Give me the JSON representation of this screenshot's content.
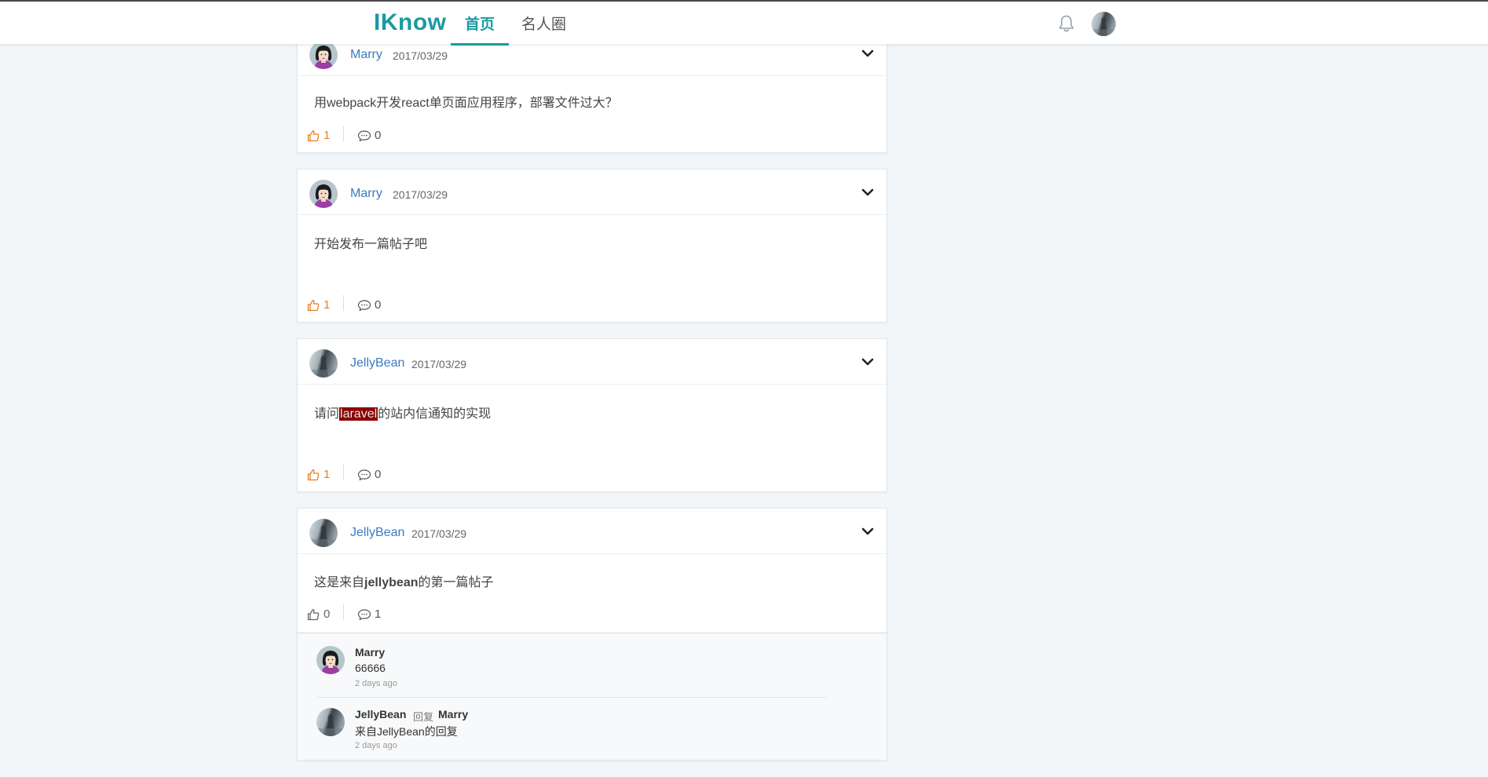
{
  "header": {
    "logo": "IKnow",
    "tabs": [
      {
        "label": "首页",
        "active": true
      },
      {
        "label": "名人圈",
        "active": false
      }
    ],
    "icons": [
      "bell-icon",
      "user-avatar"
    ],
    "accent_color": "#1a9aa3"
  },
  "posts": [
    {
      "author": "Marry",
      "date": "2017/03/29",
      "content": "用webpack开发react单页面应用程序，部署文件过大？",
      "likes": "1",
      "comments": "0"
    },
    {
      "author": "Marry",
      "date": "2017/03/29",
      "content": "开始发布一篇帖子吧",
      "likes": "1",
      "comments": "0"
    },
    {
      "author": "JellyBean",
      "date": "2017/03/29",
      "content_before": "请问",
      "content_highlight": "laravel",
      "content_after": "的站内信通知的实现",
      "likes": "1",
      "comments": "0"
    },
    {
      "author": "JellyBean",
      "date": "2017/03/29",
      "content_before": "这是来自",
      "content_bold": "jellybean",
      "content_after": "的第一篇帖子",
      "likes": "0",
      "comments": "1"
    }
  ],
  "comments": [
    {
      "author": "Marry",
      "text": "66666",
      "time": "2 days ago"
    },
    {
      "author": "JellyBean",
      "reply_label": "回复",
      "reply_to": "Marry",
      "text": "来自JellyBean的回复",
      "time": "2 days ago"
    }
  ],
  "colors": {
    "like_active": "#e67e22",
    "author_link": "#3a7bbf",
    "highlight_bg": "#8b0000"
  }
}
